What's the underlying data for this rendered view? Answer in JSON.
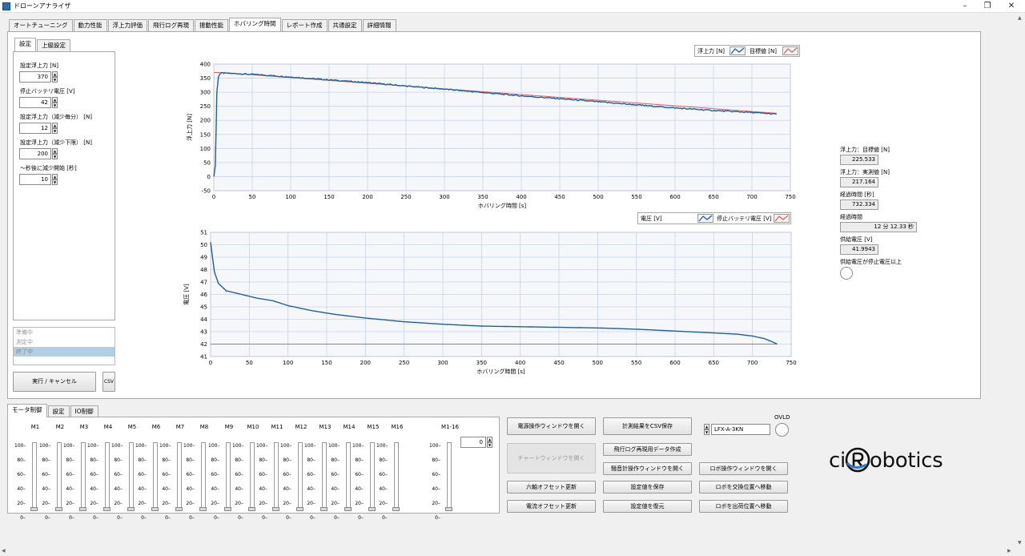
{
  "window": {
    "title": "ドローンアナライザ",
    "minimize": "–",
    "maximize": "❐",
    "close": "✕"
  },
  "main_tabs": [
    "オートチューニング",
    "動力性能",
    "浮上力評価",
    "飛行ログ再現",
    "振動性能",
    "ホバリング時間",
    "レポート作成",
    "共通設定",
    "詳細情報"
  ],
  "active_main_tab": "ホバリング時間",
  "settings": {
    "tabs": [
      "設定",
      "上級設定"
    ],
    "fields": [
      {
        "label": "設定浮上力 [N]",
        "value": "370"
      },
      {
        "label": "停止バッテリ電圧 [V]",
        "value": "42"
      },
      {
        "label": "設定浮上力（減少毎分） [N]",
        "value": "12"
      },
      {
        "label": "設定浮上力（減少下限） [N]",
        "value": "200"
      },
      {
        "label": "〜秒後に減少開始 [秒]",
        "value": "10"
      }
    ]
  },
  "status_list": [
    "準備中",
    "測定中",
    "終了中"
  ],
  "run_button": "実行 / キャンセル",
  "csv_button": "CSV",
  "indicators": [
    {
      "label": "浮上力：目標値 [N]",
      "value": "225.533"
    },
    {
      "label": "浮上力：実測値 [N]",
      "value": "217.164"
    },
    {
      "label": "経過時間 [秒]",
      "value": "732.334"
    },
    {
      "label": "経過時間",
      "value": "12 分 12.33 秒"
    },
    {
      "label": "供給電圧 [V]",
      "value": "41.9943"
    }
  ],
  "voltage_led_label": "供給電圧が停止電圧以上",
  "bottom_tabs": [
    "モータ制御",
    "設定",
    "IO制御"
  ],
  "motors": [
    "M1",
    "M2",
    "M3",
    "M4",
    "M5",
    "M6",
    "M7",
    "M8",
    "M9",
    "M10",
    "M11",
    "M12",
    "M13",
    "M14",
    "M15",
    "M16"
  ],
  "motor_all": {
    "label": "M1-16",
    "value": "0"
  },
  "slider_ticks": [
    "100",
    "80",
    "60",
    "40",
    "20",
    "0"
  ],
  "motor_levels": [
    0,
    0,
    0,
    0,
    0,
    0,
    0,
    0,
    0,
    0,
    0,
    0,
    0,
    0,
    0,
    0,
    0
  ],
  "buttons": {
    "power_window": "電源操作ウィンドウを開く",
    "save_csv": "計測結果をCSV保存",
    "chart_window": "チャートウィンドウを開く",
    "flight_log_chart": "飛行ログ再現用データ作成",
    "six_axis_offset": "六軸オフセット更新",
    "noise_window": "騒音計操作ウィンドウを開く",
    "robot_window": "ロボ操作ウィンドウを開く",
    "current_offset": "電流オフセット更新",
    "save_settings": "設定値を保存",
    "robot_exchange": "ロボを交換位置へ移動",
    "restore_settings": "設定値を復元",
    "robot_initial": "ロボを出荷位置へ移動"
  },
  "device": {
    "value": "LFX-A-3KN",
    "ovld_label": "OVLD"
  },
  "logo": {
    "left": "ci",
    "right": "obotics"
  },
  "chart_data": [
    {
      "type": "line",
      "xlabel": "ホバリング時間 [s]",
      "ylabel": "浮上力 [N]",
      "xlim": [
        0,
        750
      ],
      "ylim": [
        -50,
        400
      ],
      "xticks": [
        0,
        50,
        100,
        150,
        200,
        250,
        300,
        350,
        400,
        450,
        500,
        550,
        600,
        650,
        700,
        750
      ],
      "yticks": [
        -50,
        0,
        50,
        100,
        150,
        200,
        250,
        300,
        350,
        400
      ],
      "grid": true,
      "legend_position": "top-right",
      "series": [
        {
          "name": "浮上力 [N]",
          "color": "#1f5f9e",
          "x": [
            0,
            2,
            4,
            6,
            8,
            10,
            30,
            60,
            100,
            150,
            200,
            250,
            300,
            350,
            400,
            450,
            500,
            550,
            600,
            650,
            700,
            732
          ],
          "y": [
            0,
            40,
            300,
            355,
            365,
            368,
            366,
            362,
            354,
            344,
            334,
            322,
            311,
            299,
            287,
            277,
            266,
            255,
            244,
            235,
            228,
            222
          ]
        },
        {
          "name": "目標値 [N]",
          "color": "#e06060",
          "x": [
            0,
            10,
            10,
            732
          ],
          "y": [
            370,
            370,
            370,
            225
          ]
        }
      ]
    },
    {
      "type": "line",
      "xlabel": "ホバリング時間 [s]",
      "ylabel": "電圧 [V]",
      "xlim": [
        0,
        750
      ],
      "ylim": [
        41,
        51
      ],
      "xticks": [
        0,
        50,
        100,
        150,
        200,
        250,
        300,
        350,
        400,
        450,
        500,
        550,
        600,
        650,
        700,
        750
      ],
      "yticks": [
        41,
        42,
        43,
        44,
        45,
        46,
        47,
        48,
        49,
        50,
        51
      ],
      "grid": true,
      "legend_position": "top-right",
      "series": [
        {
          "name": "電圧 [V]",
          "color": "#1f5f9e",
          "x": [
            0,
            2,
            5,
            10,
            20,
            40,
            60,
            80,
            100,
            130,
            160,
            200,
            250,
            300,
            350,
            400,
            450,
            500,
            550,
            600,
            650,
            680,
            700,
            715,
            725,
            732
          ],
          "y": [
            50.2,
            49.2,
            47.8,
            46.9,
            46.3,
            46.0,
            45.7,
            45.5,
            45.1,
            44.7,
            44.4,
            44.1,
            43.8,
            43.6,
            43.45,
            43.4,
            43.35,
            43.3,
            43.2,
            43.05,
            42.9,
            42.8,
            42.65,
            42.45,
            42.2,
            42.0
          ]
        },
        {
          "name": "停止バッテリ電圧 [V]",
          "color": "#e06060",
          "x": [
            0,
            732
          ],
          "y": [
            42,
            42
          ]
        }
      ]
    }
  ]
}
